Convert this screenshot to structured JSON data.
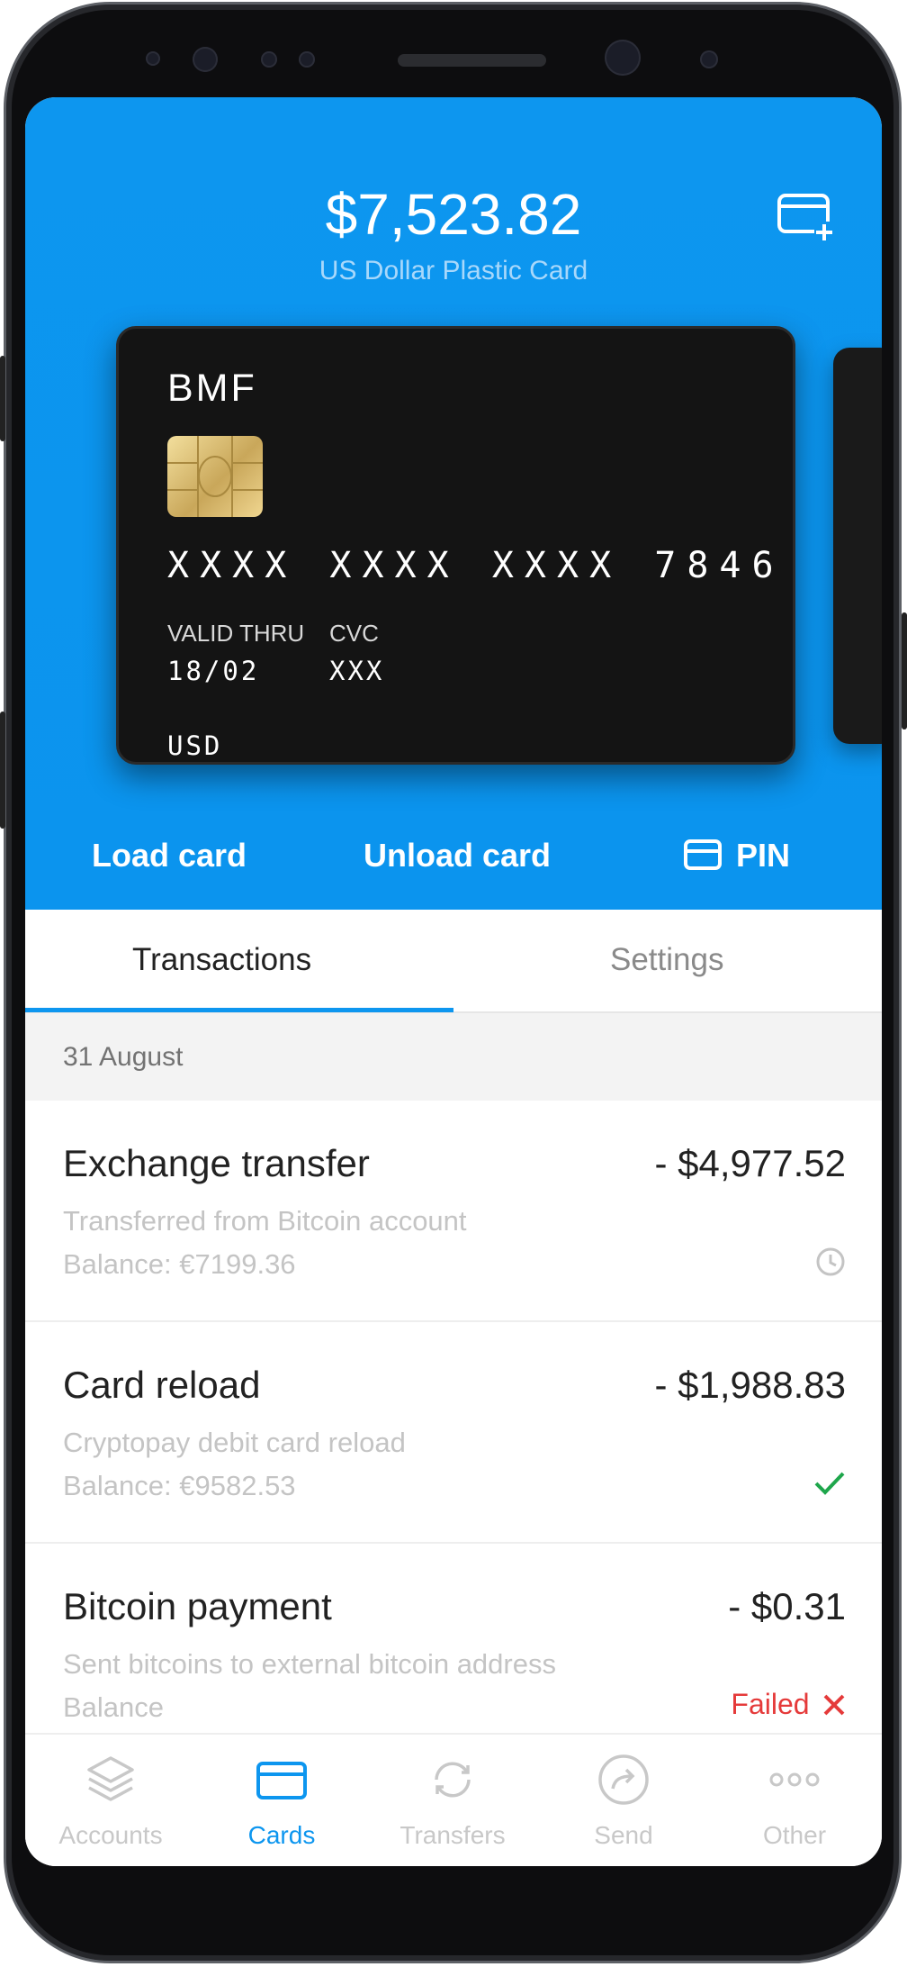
{
  "header": {
    "balance": "$7,523.82",
    "card_name": "US Dollar Plastic Card",
    "add_card_icon": "add-card-icon"
  },
  "card": {
    "brand": "BMF",
    "number": "XXXX XXXX XXXX 7846",
    "valid_thru_label": "VALID THRU",
    "valid_thru": "18/02",
    "cvc_label": "CVC",
    "cvc": "XXX",
    "currency": "USD"
  },
  "actions": {
    "load": "Load card",
    "unload": "Unload card",
    "pin": "PIN"
  },
  "tabs": {
    "active": "Transactions",
    "items": [
      "Transactions",
      "Settings"
    ]
  },
  "transactions": {
    "date": "31 August",
    "items": [
      {
        "title": "Exchange transfer",
        "amount": "- $4,977.52",
        "description": "Transferred from Bitcoin account",
        "balance": "Balance: €7199.36",
        "status_icon": "clock-icon"
      },
      {
        "title": "Card reload",
        "amount": "- $1,988.83",
        "description": "Cryptopay debit card reload",
        "balance": "Balance: €9582.53",
        "status_icon": "check-icon"
      },
      {
        "title": "Bitcoin payment",
        "amount": "- $0.31",
        "description": "Sent bitcoins to external bitcoin address",
        "balance": "Balance",
        "status": "Failed",
        "status_icon": "close-icon"
      }
    ]
  },
  "nav": {
    "active": "Cards",
    "items": [
      "Accounts",
      "Cards",
      "Transfers",
      "Send",
      "Other"
    ]
  },
  "colors": {
    "accent": "#0d96ef",
    "success": "#1ea64b",
    "error": "#e53a3a"
  }
}
